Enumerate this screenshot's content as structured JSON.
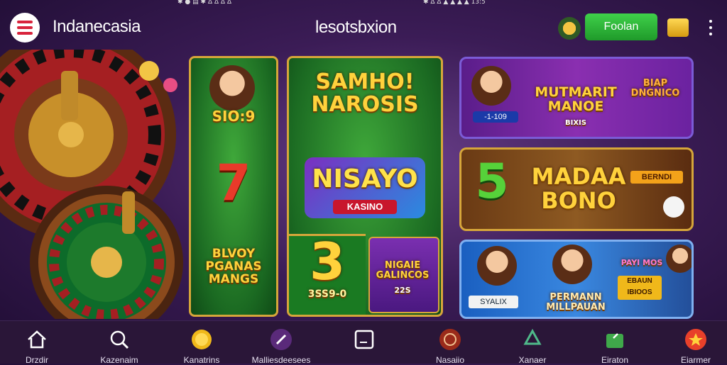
{
  "status_bar": {
    "left": "✱ ● ▤ ✱ Δ Δ Δ Δ",
    "right": "✱ Δ Δ ▲ ▲ ▲ ▲ 13:5"
  },
  "header": {
    "region": "Indanecasia",
    "title": "lesotsbxion",
    "login_label": "Foolan"
  },
  "banners": {
    "left_top": "SIO:9",
    "left_mid": "7",
    "left_bottom": "BLVOY PGANAS MANGS",
    "center_top": "SAMHO! NAROSIS",
    "center_logo": "NISAYO",
    "center_logo_sub": "KASINO",
    "center_num": "3",
    "center_num_sub": "3SS9-0",
    "center_small": "NIGAIE GALINCOS",
    "center_small_sub": "22S",
    "right_top_title": "MUTMARIT MANOE",
    "right_top_sub": "BIXIS",
    "right_top_tag": "BIAP DNGNICO",
    "right_top_badge": "-1-109",
    "right_mid_num": "5",
    "right_mid_title": "MADAA BONO",
    "right_mid_tag": "BERNDI",
    "right_bot_title": "PERMANN MILLPAUAN",
    "right_bot_left": "SYALIX",
    "right_bot_tag": "PAYI MOS",
    "right_bot_tag2": "EBAUN IBIOOS"
  },
  "nav": [
    {
      "label": "Drzdir",
      "icon": "home-icon"
    },
    {
      "label": "Kazenaim",
      "icon": "search-icon"
    },
    {
      "label": "Kanatrins",
      "icon": "coins-icon"
    },
    {
      "label": "Malliesdeesees",
      "icon": "pen-icon"
    },
    {
      "label": "",
      "icon": "square-icon"
    },
    {
      "label": "Nasaiio",
      "icon": "chip-icon"
    },
    {
      "label": "Xanaer",
      "icon": "recycle-icon"
    },
    {
      "label": "Eiraton",
      "icon": "map-icon"
    },
    {
      "label": "Eiarmer",
      "icon": "star-icon"
    }
  ],
  "colors": {
    "accent_green": "#2fbf3a",
    "gold": "#ffd23c",
    "brand_red": "#d8233c",
    "nav_bg": "#2a1638"
  }
}
